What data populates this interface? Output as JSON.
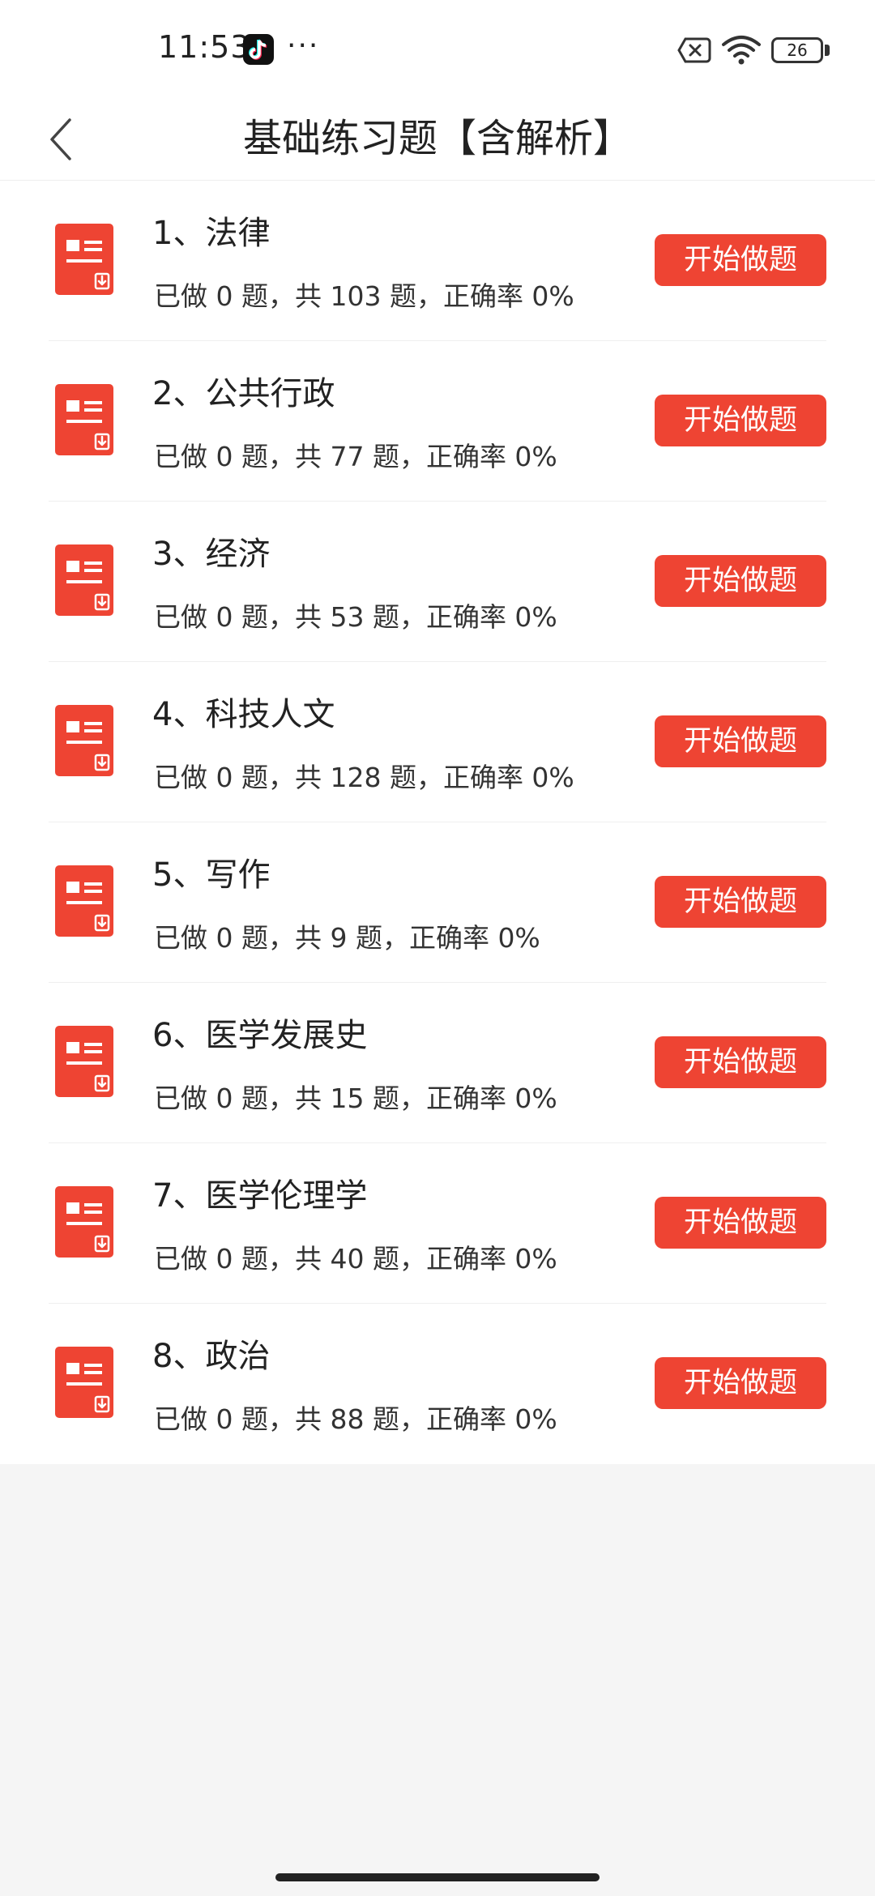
{
  "status_bar": {
    "time": "11:53",
    "more": "···",
    "battery_level": "26",
    "icons": [
      "tiktok-icon",
      "sim-off-icon",
      "wifi-icon",
      "battery-icon"
    ]
  },
  "header": {
    "title": "基础练习题【含解析】",
    "back_icon": "chevron-left-icon"
  },
  "list": {
    "button_label": "开始做题",
    "icon": "document-icon",
    "accent_color": "#ee4433",
    "items": [
      {
        "title": "1、法律",
        "stats": "已做 0 题，共 103 题，正确率 0%"
      },
      {
        "title": "2、公共行政",
        "stats": "已做 0 题，共 77 题，正确率 0%"
      },
      {
        "title": "3、经济",
        "stats": "已做 0 题，共 53 题，正确率 0%"
      },
      {
        "title": "4、科技人文",
        "stats": "已做 0 题，共 128 题，正确率 0%"
      },
      {
        "title": "5、写作",
        "stats": "已做 0 题，共 9 题，正确率 0%"
      },
      {
        "title": "6、医学发展史",
        "stats": "已做 0 题，共 15 题，正确率 0%"
      },
      {
        "title": "7、医学伦理学",
        "stats": "已做 0 题，共 40 题，正确率 0%"
      },
      {
        "title": "8、政治",
        "stats": "已做 0 题，共 88 题，正确率 0%"
      }
    ]
  }
}
